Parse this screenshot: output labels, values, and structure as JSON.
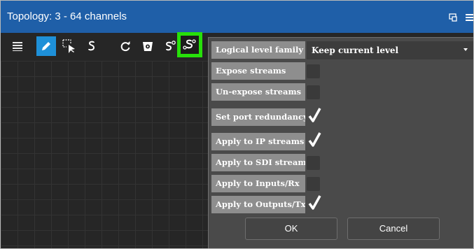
{
  "window": {
    "title": "Topology: 3 - 64 channels"
  },
  "titlebar_icons": [
    "popout-icon",
    "menu-icon"
  ],
  "toolbar": {
    "tools": [
      "list-icon",
      "edit-pencil-icon",
      "select-cursor-icon",
      "link-icon",
      "refresh-icon",
      "trash-icon",
      "stream-icon",
      "stream-settings-icon"
    ],
    "highlight_color": "#27e00a",
    "active_color": "#1e90d8"
  },
  "dialog": {
    "logical_level_family": {
      "label": "Logical level family",
      "value": "Keep current level"
    },
    "options": [
      {
        "label": "Expose streams",
        "checked": false
      },
      {
        "label": "Un-expose streams",
        "checked": false
      },
      {
        "label": "Set port redundancy",
        "checked": true
      },
      {
        "label": "Apply to IP streams",
        "checked": true
      },
      {
        "label": "Apply to SDI streams",
        "checked": false
      },
      {
        "label": "Apply to Inputs/Rx",
        "checked": false
      },
      {
        "label": "Apply to Outputs/Tx",
        "checked": true
      }
    ],
    "ok_label": "OK",
    "cancel_label": "Cancel"
  }
}
